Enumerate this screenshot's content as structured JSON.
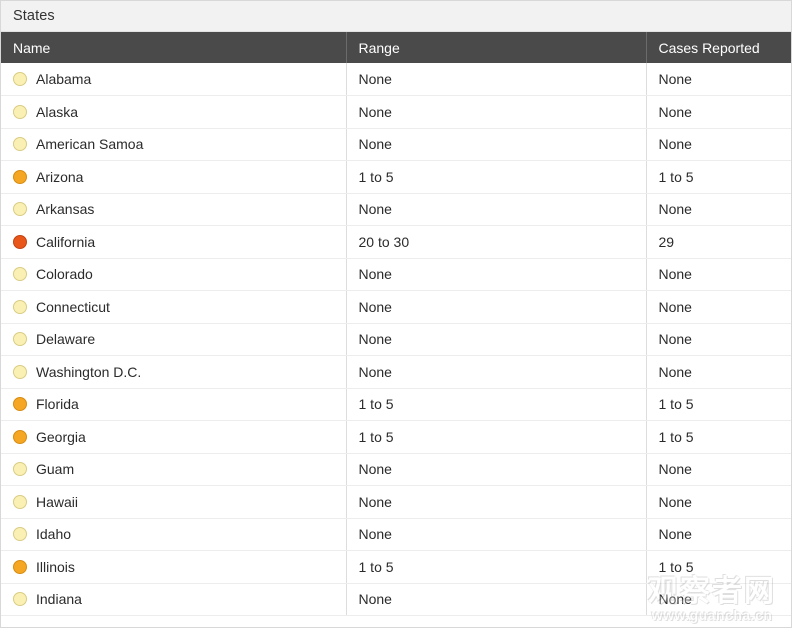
{
  "window": {
    "title": "States"
  },
  "table": {
    "columns": [
      {
        "key": "name",
        "label": "Name"
      },
      {
        "key": "range",
        "label": "Range"
      },
      {
        "key": "cases",
        "label": "Cases Reported"
      }
    ],
    "rows": [
      {
        "name": "Alabama",
        "range": "None",
        "cases": "None",
        "level": "none"
      },
      {
        "name": "Alaska",
        "range": "None",
        "cases": "None",
        "level": "none"
      },
      {
        "name": "American Samoa",
        "range": "None",
        "cases": "None",
        "level": "none"
      },
      {
        "name": "Arizona",
        "range": "1 to 5",
        "cases": "1 to 5",
        "level": "low"
      },
      {
        "name": "Arkansas",
        "range": "None",
        "cases": "None",
        "level": "none"
      },
      {
        "name": "California",
        "range": "20 to 30",
        "cases": "29",
        "level": "high"
      },
      {
        "name": "Colorado",
        "range": "None",
        "cases": "None",
        "level": "none"
      },
      {
        "name": "Connecticut",
        "range": "None",
        "cases": "None",
        "level": "none"
      },
      {
        "name": "Delaware",
        "range": "None",
        "cases": "None",
        "level": "none"
      },
      {
        "name": "Washington D.C.",
        "range": "None",
        "cases": "None",
        "level": "none"
      },
      {
        "name": "Florida",
        "range": "1 to 5",
        "cases": "1 to 5",
        "level": "low"
      },
      {
        "name": "Georgia",
        "range": "1 to 5",
        "cases": "1 to 5",
        "level": "low"
      },
      {
        "name": "Guam",
        "range": "None",
        "cases": "None",
        "level": "none"
      },
      {
        "name": "Hawaii",
        "range": "None",
        "cases": "None",
        "level": "none"
      },
      {
        "name": "Idaho",
        "range": "None",
        "cases": "None",
        "level": "none"
      },
      {
        "name": "Illinois",
        "range": "1 to 5",
        "cases": "1 to 5",
        "level": "low"
      },
      {
        "name": "Indiana",
        "range": "None",
        "cases": "None",
        "level": "none"
      }
    ]
  },
  "legend_colors": {
    "none": "#faf0b4",
    "low": "#f5a623",
    "high": "#e8561a",
    "header_background": "#4a4a4a",
    "title_background": "#f2f2f2"
  },
  "watermark": {
    "chinese": "观察者网",
    "url": "www.guancha.cn"
  }
}
